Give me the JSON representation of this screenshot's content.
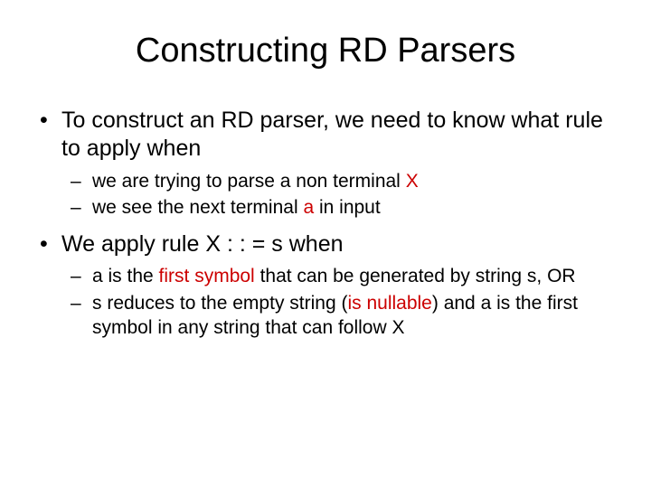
{
  "title": "Constructing RD Parsers",
  "bullets": [
    {
      "text": "To construct an RD parser, we need to know what rule to apply when",
      "subs": [
        {
          "pre": "we are trying to parse a non terminal ",
          "hl": "X",
          "post": ""
        },
        {
          "pre": "we see the next terminal ",
          "hl": "a",
          "post": " in input"
        }
      ]
    },
    {
      "text": "We apply rule  X : : = s when",
      "subs": [
        {
          "pre": "a is the ",
          "hl": "first symbol",
          "post": " that can be generated by string s, OR"
        },
        {
          "pre": "s reduces to the empty string (",
          "hl": "is nullable",
          "post": ") and a is the first symbol in any string that can follow X"
        }
      ]
    }
  ]
}
